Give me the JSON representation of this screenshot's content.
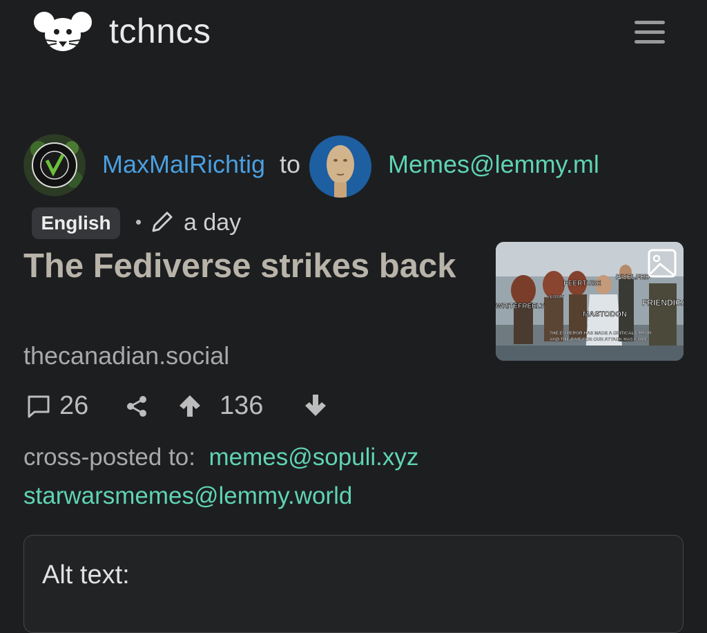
{
  "nav": {
    "brand": "tchncs",
    "logo_icon": "mouse-head-logo-icon",
    "menu_icon": "hamburger-menu-icon"
  },
  "post": {
    "author": "MaxMalRichtig",
    "to_word": "to",
    "community": "Memes@lemmy.ml",
    "language": "English",
    "separator": "•",
    "edit_icon": "pencil-icon",
    "time": "a day",
    "title": "The Fediverse strikes back",
    "domain": "thecanadian.social",
    "thumbnail_icon": "image-icon",
    "thumbnail_labels": [
      "PEERTUBE",
      "PIXELFED",
      "LEMMY",
      "WRITEFREELY",
      "FRIENDICA",
      "MASTODON",
      "THE EMPEROR HAS MADE A CRITICAL ERROR",
      "AND THE TIME FOR OUR ATTACK HAS COME"
    ]
  },
  "actions": {
    "comments_icon": "comment-icon",
    "comments": "26",
    "share_icon": "share-icon",
    "upvote_icon": "arrow-up-icon",
    "score": "136",
    "downvote_icon": "arrow-down-icon"
  },
  "crosspost": {
    "label": "cross-posted to:",
    "links": [
      "memes@sopuli.xyz",
      "starwarsmemes@lemmy.world"
    ]
  },
  "alt": {
    "label": "Alt text:"
  },
  "colors": {
    "background": "#1d1e20",
    "link_blue": "#4a9fe0",
    "link_teal": "#5fd4b2",
    "title": "#b9b4aa"
  }
}
